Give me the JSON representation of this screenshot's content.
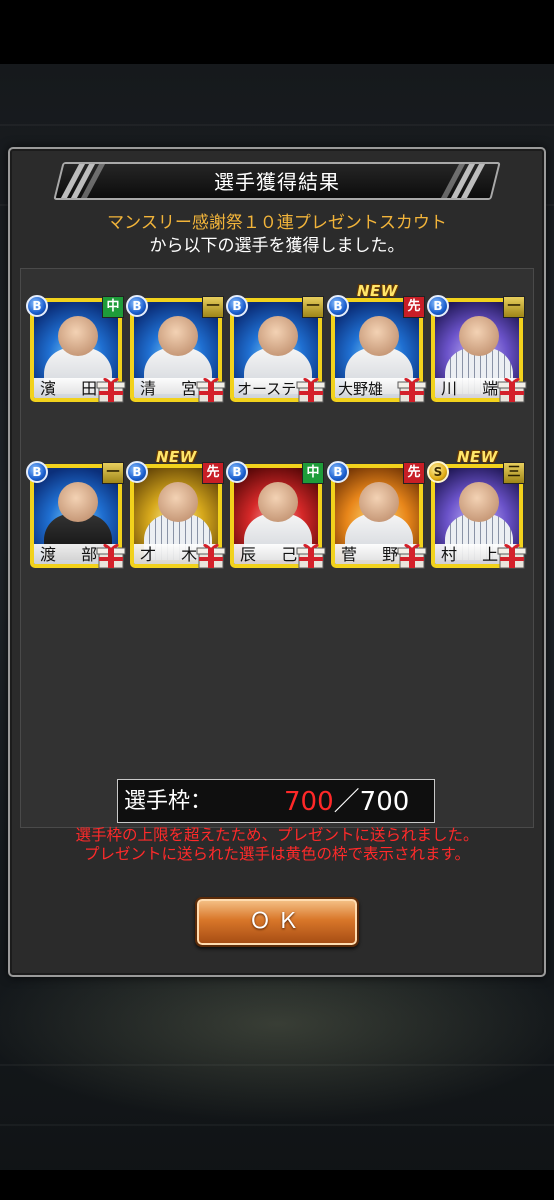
{
  "dialog": {
    "title": "選手獲得結果",
    "scout_name": "マンスリー感謝祭１０連プレゼントスカウト",
    "subtitle": "から以下の選手を獲得しました。"
  },
  "players": [
    {
      "name": "濱 田",
      "rank": "B",
      "position": "中",
      "pos_color": "#1e9c3a",
      "new": false,
      "bg": "bg-blue",
      "uniform": "uni-white"
    },
    {
      "name": "清 宮",
      "rank": "B",
      "position": "一",
      "pos_color": "#b8a030",
      "new": false,
      "bg": "bg-blue",
      "uniform": "uni-white"
    },
    {
      "name": "オーステ",
      "rank": "B",
      "position": "一",
      "pos_color": "#b8a030",
      "new": false,
      "bg": "bg-blue",
      "uniform": "uni-white"
    },
    {
      "name": "大野雄",
      "rank": "B",
      "position": "先",
      "pos_color": "#c81e26",
      "new": true,
      "bg": "bg-blue",
      "uniform": "uni-white"
    },
    {
      "name": "川 端",
      "rank": "B",
      "position": "一",
      "pos_color": "#b8a030",
      "new": false,
      "bg": "bg-purple",
      "uniform": "uni-pin"
    },
    {
      "name": "渡 部",
      "rank": "B",
      "position": "一",
      "pos_color": "#b8a030",
      "new": false,
      "bg": "bg-blue",
      "uniform": "uni-black"
    },
    {
      "name": "才 木",
      "rank": "B",
      "position": "先",
      "pos_color": "#c81e26",
      "new": true,
      "bg": "bg-gold",
      "uniform": "uni-pin"
    },
    {
      "name": "辰 己",
      "rank": "B",
      "position": "中",
      "pos_color": "#1e9c3a",
      "new": false,
      "bg": "bg-red",
      "uniform": "uni-white"
    },
    {
      "name": "菅 野",
      "rank": "B",
      "position": "先",
      "pos_color": "#c81e26",
      "new": false,
      "bg": "bg-orange",
      "uniform": "uni-white"
    },
    {
      "name": "村 上",
      "rank": "S",
      "position": "三",
      "pos_color": "#b8a030",
      "new": true,
      "bg": "bg-purple",
      "uniform": "uni-pin"
    }
  ],
  "new_label": "NEW",
  "roster": {
    "label": "選手枠：",
    "current": "700",
    "separator": "／",
    "max": "700"
  },
  "notice": {
    "line1": "選手枠の上限を超えたため、プレゼントに送られました。",
    "line2": "プレゼントに送られた選手は黄色の枠で表示されます。"
  },
  "ok_button": "ＯＫ",
  "colors": {
    "accent_orange": "#f2b43a",
    "warning_red": "#ff2a2a",
    "frame_yellow": "#f2d21c"
  }
}
